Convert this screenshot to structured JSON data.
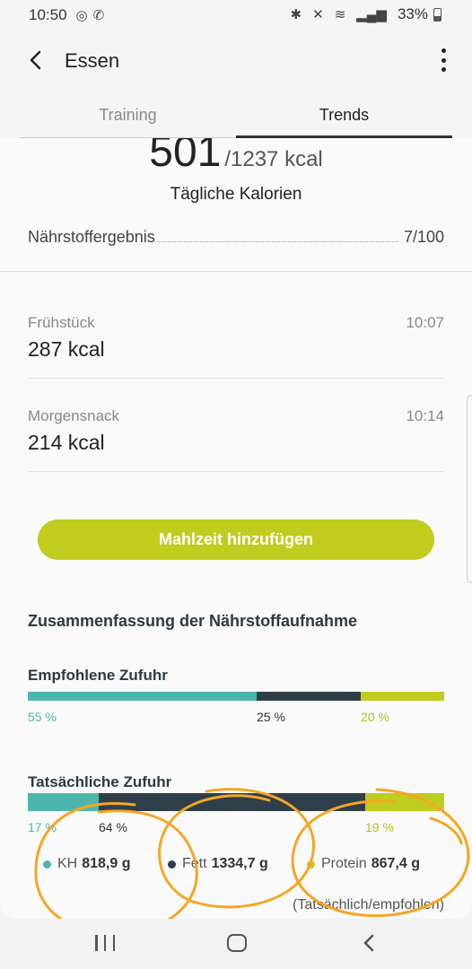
{
  "status_bar": {
    "time": "10:50",
    "battery": "33%"
  },
  "app_bar": {
    "title": "Essen"
  },
  "tabs": [
    {
      "label": "Training",
      "active": false
    },
    {
      "label": "Trends",
      "active": true
    }
  ],
  "calories": {
    "consumed": "501",
    "goal": "/1237 kcal",
    "label": "Tägliche Kalorien"
  },
  "nutrient_score": {
    "label": "Nährstoffergebnis",
    "value": "7/100"
  },
  "meals": [
    {
      "name": "Frühstück",
      "time": "10:07",
      "kcal": "287 kcal"
    },
    {
      "name": "Morgensnack",
      "time": "10:14",
      "kcal": "214 kcal"
    }
  ],
  "add_meal_label": "Mahlzeit hinzufügen",
  "summary": {
    "title": "Zusammenfassung der Nährstoffaufnahme",
    "recommended": {
      "label": "Empfohlene Zufuhr",
      "carbs_pct": "55 %",
      "fat_pct": "25 %",
      "protein_pct": "20 %",
      "carbs_fraction": 0.55,
      "fat_fraction": 0.25,
      "protein_fraction": 0.2
    },
    "actual": {
      "label": "Tatsächliche Zufuhr",
      "carbs_pct": "17 %",
      "fat_pct": "64 %",
      "protein_pct": "19 %",
      "carbs_fraction": 0.17,
      "fat_fraction": 0.64,
      "protein_fraction": 0.19
    },
    "legend": [
      {
        "name": "KH",
        "value": "818,9 g",
        "color": "#4db6ac"
      },
      {
        "name": "Fett",
        "value": "1334,7 g",
        "color": "#2f3f4a"
      },
      {
        "name": "Protein",
        "value": "867,4 g",
        "color": "#c0cc1e"
      }
    ],
    "ratio_note": "(Tatsächlich/empfohlen)"
  },
  "colors": {
    "carbs": "#4db6ac",
    "fat": "#2f3f4a",
    "protein": "#c0cc1e",
    "accent": "#c0cc1e",
    "annotation": "#f5a623"
  }
}
